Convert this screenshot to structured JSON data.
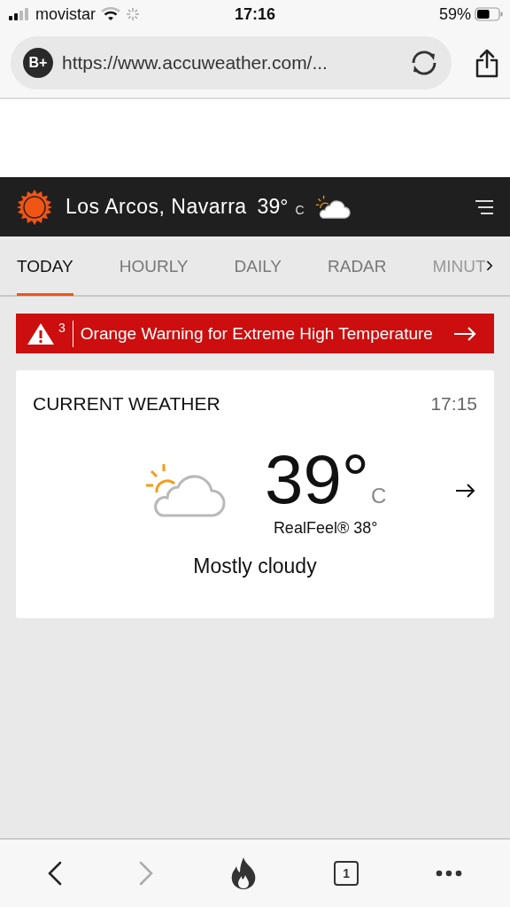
{
  "status_bar": {
    "carrier": "movistar",
    "time": "17:16",
    "battery": "59%"
  },
  "browser": {
    "badge": "B+",
    "url": "https://www.accuweather.com/...",
    "tab_count": "1",
    "back_disabled": false,
    "forward_disabled": true
  },
  "header": {
    "location": "Los Arcos, Navarra",
    "temperature": "39°",
    "unit": "C"
  },
  "tabs": [
    {
      "label": "TODAY",
      "selected": true
    },
    {
      "label": "HOURLY",
      "selected": false
    },
    {
      "label": "DAILY",
      "selected": false
    },
    {
      "label": "RADAR",
      "selected": false
    },
    {
      "label": "MINUT",
      "selected": false
    }
  ],
  "alert": {
    "count": "3",
    "text": "Orange Warning for Extreme High Temperature"
  },
  "current_weather": {
    "title": "CURRENT WEATHER",
    "time": "17:15",
    "temperature": "39°",
    "unit": "C",
    "realfeel": "RealFeel® 38°",
    "condition": "Mostly cloudy"
  }
}
